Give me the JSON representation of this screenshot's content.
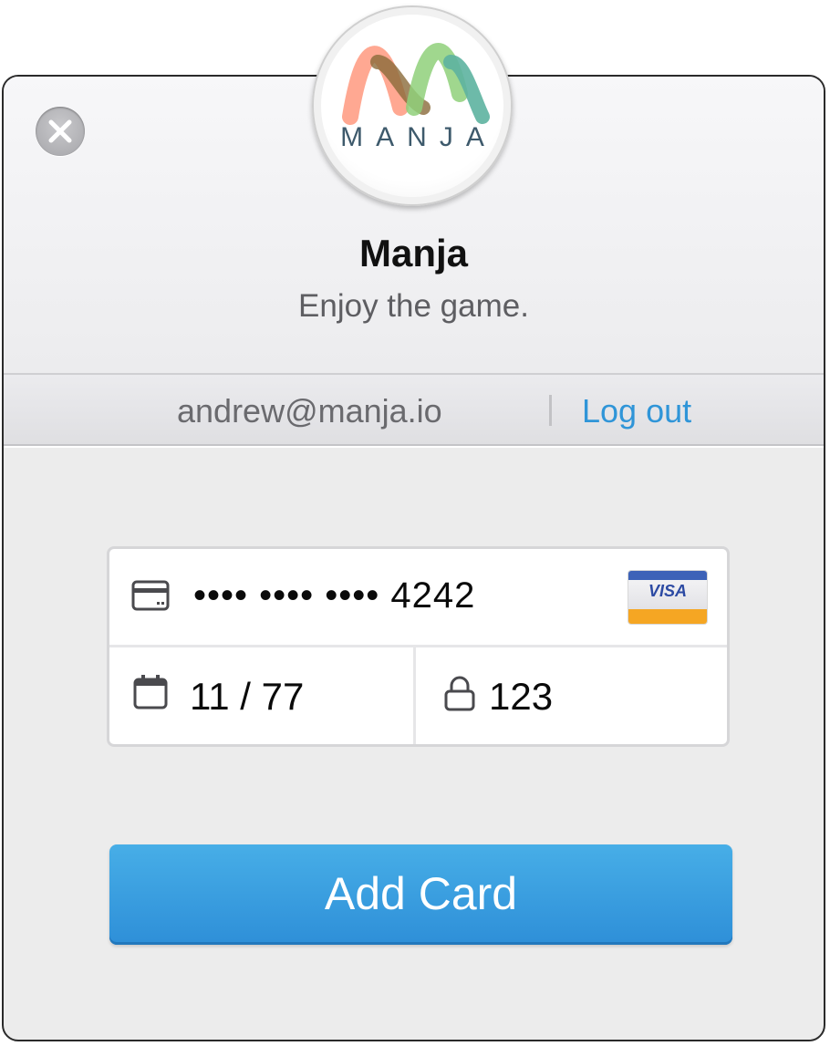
{
  "header": {
    "title": "Manja",
    "subtitle": "Enjoy the game.",
    "logo_text": "MANJA"
  },
  "account": {
    "email": "andrew@manja.io",
    "logout_label": "Log out"
  },
  "card": {
    "number_masked": "•••• •••• •••• 4242",
    "brand": "VISA",
    "expiry": "11 / 77",
    "cvc": "123"
  },
  "actions": {
    "submit_label": "Add Card"
  },
  "icons": {
    "close": "close-icon",
    "card": "credit-card-icon",
    "calendar": "calendar-icon",
    "lock": "lock-icon"
  },
  "colors": {
    "accent": "#2f95d8",
    "button": "#3a9fe0",
    "logo_coral": "#ff9f86",
    "logo_green": "#8fd07a",
    "logo_teal": "#5db3a0"
  }
}
